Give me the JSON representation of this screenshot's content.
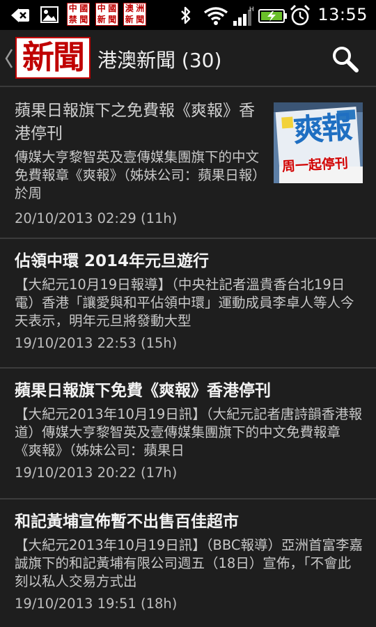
{
  "status_bar": {
    "time": "13:55",
    "mini_logos": [
      [
        "中",
        "國",
        "禁",
        "聞"
      ],
      [
        "中",
        "國",
        "新",
        "聞"
      ],
      [
        "澳",
        "洲",
        "新",
        "聞"
      ]
    ],
    "icons": [
      "back-arrow-icon",
      "image-icon",
      "bluetooth-icon",
      "wifi-icon",
      "signal-icon",
      "battery-charging-icon",
      "alarm-icon"
    ]
  },
  "action_bar": {
    "logo_text": "新聞",
    "title": "港澳新聞 (30)",
    "accent": "#c00000"
  },
  "news": [
    {
      "title": "蘋果日報旗下之免費報《爽報》香港停刊",
      "summary": "傳媒大亨黎智英及壹傳媒集團旗下的中文免費報章《爽報》（姊妹公司：蘋果日報）於周",
      "time": "20/10/2013 02:29 (11h)",
      "thumb_headline": "爽報",
      "thumb_caption": "周一起停刊"
    },
    {
      "title": "佔領中環 2014年元旦遊行",
      "summary": "【大紀元10月19日報導】（中央社記者溫貴香台北19日電）香港「讓愛與和平佔領中環」運動成員李卓人等人今天表示，明年元旦將發動大型",
      "time": "19/10/2013 22:53 (15h)"
    },
    {
      "title": "蘋果日報旗下免費《爽報》香港停刊",
      "summary": "【大紀元2013年10月19日訊】（大紀元記者唐詩韻香港報道）傳媒大亨黎智英及壹傳媒集團旗下的中文免費報章《爽報》（姊妹公司：蘋果日",
      "time": "19/10/2013 20:22 (17h)"
    },
    {
      "title": "和記黃埔宣佈暫不出售百佳超市",
      "summary": "【大紀元2013年10月19日訊】（BBC報導）亞洲首富李嘉誠旗下的和記黃埔有限公司週五（18日）宣佈，「不會此刻以私人交易方式出",
      "time": "19/10/2013 19:51 (18h)"
    }
  ]
}
